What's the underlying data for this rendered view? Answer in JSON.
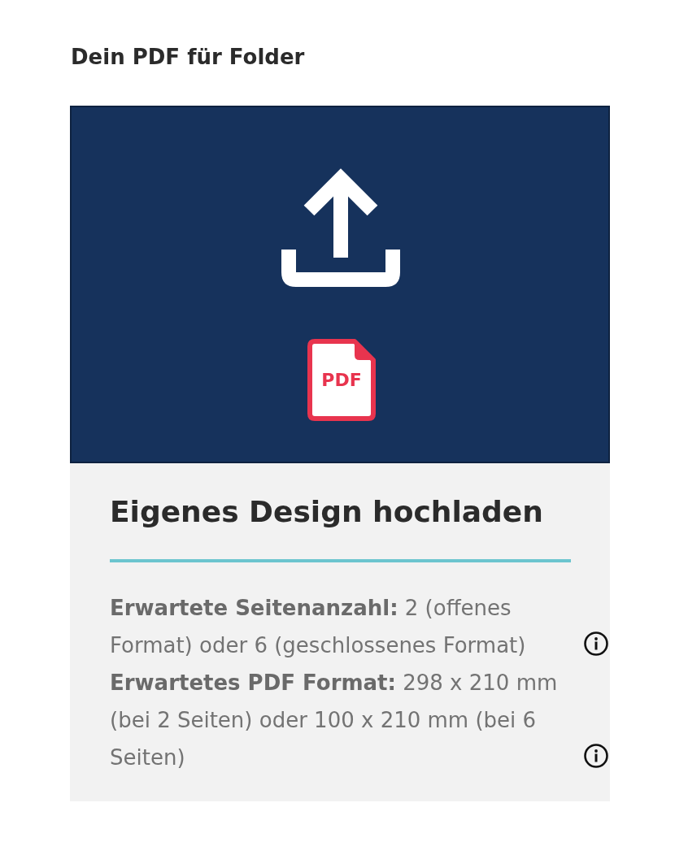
{
  "heading": "Dein PDF für Folder",
  "upload_panel": {
    "file_type": "PDF"
  },
  "details": {
    "title": "Eigenes Design hochladen",
    "specs": [
      {
        "text": "**Erwartete Seitenanzahl:** 2 (offenes Format) oder 6 (geschlossenes Format)"
      },
      {
        "text": "**Erwartetes PDF Format:** 298 x 210 mm (bei 2 Seiten) oder 100 x 210 mm (bei 6 Seiten)"
      }
    ]
  }
}
